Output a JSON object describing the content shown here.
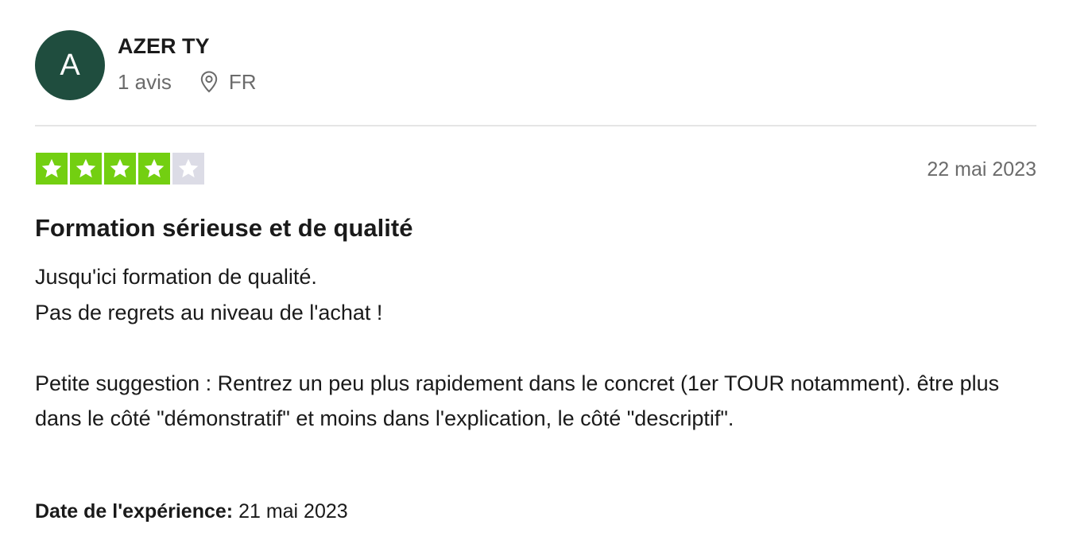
{
  "consumer": {
    "avatar_initial": "A",
    "name": "AZER TY",
    "reviews_count": "1 avis",
    "country": "FR"
  },
  "review": {
    "rating": 4,
    "rating_max": 5,
    "date": "22 mai 2023",
    "title": "Formation sérieuse et de qualité",
    "body_paragraph_1": "Jusqu'ici formation de qualité.\nPas de regrets au niveau de l'achat !",
    "body_paragraph_2": "Petite suggestion : Rentrez un peu plus rapidement dans le concret (1er TOUR notamment). être plus dans le côté \"démonstratif\" et moins dans l'explication, le côté \"descriptif\".",
    "experience_label": "Date de l'expérience:",
    "experience_date": "21 mai 2023"
  },
  "icons": {
    "location": "location-pin-icon",
    "star": "star-icon"
  },
  "colors": {
    "avatar_bg": "#1f4d3e",
    "star_filled": "#73cf11",
    "star_empty": "#dcdce6",
    "muted_text": "#6b6b6b",
    "divider": "#e5e5e5"
  }
}
